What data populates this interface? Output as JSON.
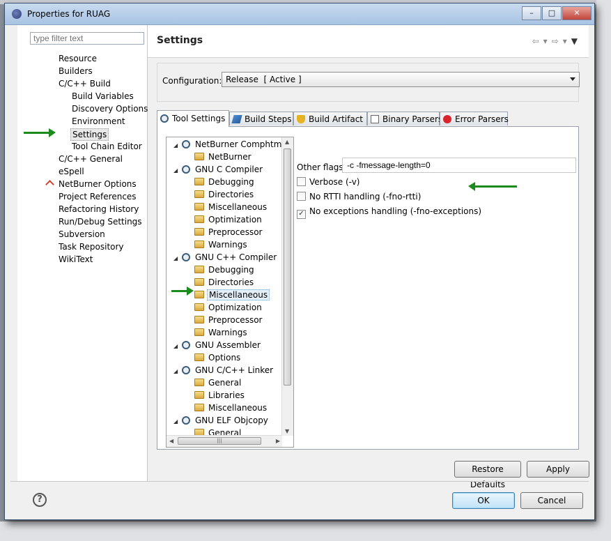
{
  "window": {
    "title": "Properties for RUAG"
  },
  "filter": {
    "placeholder": "type filter text"
  },
  "nav": {
    "items": [
      {
        "label": "Resource",
        "level": 0
      },
      {
        "label": "Builders",
        "level": 0
      },
      {
        "label": "C/C++ Build",
        "level": 0
      },
      {
        "label": "Build Variables",
        "level": 1
      },
      {
        "label": "Discovery Options",
        "level": 1
      },
      {
        "label": "Environment",
        "level": 1
      },
      {
        "label": "Settings",
        "level": 1,
        "selected": true
      },
      {
        "label": "Tool Chain Editor",
        "level": 1
      },
      {
        "label": "C/C++ General",
        "level": 0
      },
      {
        "label": "eSpell",
        "level": 0
      },
      {
        "label": "NetBurner Options",
        "level": 0,
        "icon": "netburner-icon"
      },
      {
        "label": "Project References",
        "level": 0
      },
      {
        "label": "Refactoring History",
        "level": 0
      },
      {
        "label": "Run/Debug Settings",
        "level": 0
      },
      {
        "label": "Subversion",
        "level": 0
      },
      {
        "label": "Task Repository",
        "level": 0
      },
      {
        "label": "WikiText",
        "level": 0
      }
    ]
  },
  "page": {
    "title": "Settings"
  },
  "config": {
    "label": "Configuration:",
    "value": "Release  [ Active ]"
  },
  "tabs": [
    {
      "label": "Tool Settings",
      "active": true,
      "icon": "gear-icon"
    },
    {
      "label": "Build Steps",
      "icon": "build-steps-icon"
    },
    {
      "label": "Build Artifact",
      "icon": "trophy-icon"
    },
    {
      "label": "Binary Parsers",
      "icon": "binary-icon"
    },
    {
      "label": "Error Parsers",
      "icon": "error-icon"
    }
  ],
  "tree": [
    {
      "label": "NetBurner Comphtml",
      "type": "tool"
    },
    {
      "label": "NetBurner",
      "type": "option"
    },
    {
      "label": "GNU C Compiler",
      "type": "tool"
    },
    {
      "label": "Debugging",
      "type": "option"
    },
    {
      "label": "Directories",
      "type": "option"
    },
    {
      "label": "Miscellaneous",
      "type": "option"
    },
    {
      "label": "Optimization",
      "type": "option"
    },
    {
      "label": "Preprocessor",
      "type": "option"
    },
    {
      "label": "Warnings",
      "type": "option"
    },
    {
      "label": "GNU C++ Compiler",
      "type": "tool"
    },
    {
      "label": "Debugging",
      "type": "option"
    },
    {
      "label": "Directories",
      "type": "option"
    },
    {
      "label": "Miscellaneous",
      "type": "option",
      "selected": true
    },
    {
      "label": "Optimization",
      "type": "option"
    },
    {
      "label": "Preprocessor",
      "type": "option"
    },
    {
      "label": "Warnings",
      "type": "option"
    },
    {
      "label": "GNU Assembler",
      "type": "tool"
    },
    {
      "label": "Options",
      "type": "option"
    },
    {
      "label": "GNU C/C++ Linker",
      "type": "tool"
    },
    {
      "label": "General",
      "type": "option"
    },
    {
      "label": "Libraries",
      "type": "option"
    },
    {
      "label": "Miscellaneous",
      "type": "option"
    },
    {
      "label": "GNU ELF Objcopy",
      "type": "tool"
    },
    {
      "label": "General",
      "type": "option"
    }
  ],
  "settings": {
    "other_flags_label": "Other flags",
    "other_flags_value": "-c -fmessage-length=0",
    "checkboxes": [
      {
        "label": "Verbose (-v)",
        "checked": false
      },
      {
        "label": "No RTTI handling (-fno-rtti)",
        "checked": false
      },
      {
        "label": "No exceptions handling (-fno-exceptions)",
        "checked": true
      }
    ]
  },
  "buttons": {
    "restore_defaults": "Restore Defaults",
    "apply": "Apply",
    "ok": "OK",
    "cancel": "Cancel"
  },
  "colors": {
    "annotation_arrow": "#1c8a1c",
    "title_bar": "#b6cce8"
  }
}
